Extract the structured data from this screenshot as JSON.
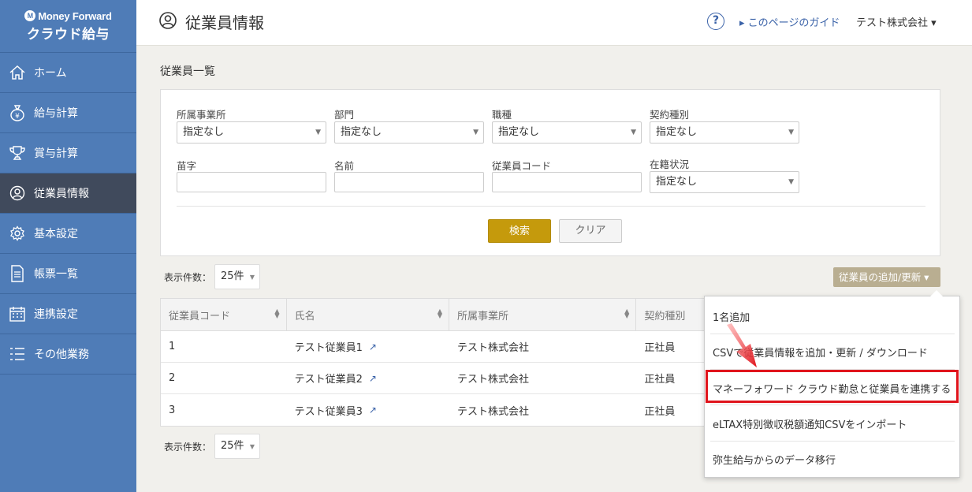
{
  "logo": {
    "brand": "Money Forward",
    "product": "クラウド給与"
  },
  "sidebar": {
    "items": [
      {
        "label": "ホーム",
        "icon": "home-icon",
        "active": false
      },
      {
        "label": "給与計算",
        "icon": "money-bag-icon",
        "active": false
      },
      {
        "label": "賞与計算",
        "icon": "trophy-icon",
        "active": false
      },
      {
        "label": "従業員情報",
        "icon": "user-icon",
        "active": true
      },
      {
        "label": "基本設定",
        "icon": "gear-icon",
        "active": false
      },
      {
        "label": "帳票一覧",
        "icon": "document-icon",
        "active": false
      },
      {
        "label": "連携設定",
        "icon": "calendar-icon",
        "active": false
      },
      {
        "label": "その他業務",
        "icon": "list-icon",
        "active": false
      }
    ]
  },
  "header": {
    "title": "従業員情報",
    "help": "?",
    "guide_link": "▸ このページのガイド",
    "company": "テスト株式会社 ▾"
  },
  "main": {
    "section_title": "従業員一覧",
    "filters": {
      "office_label": "所属事業所",
      "office_value": "指定なし",
      "dept_label": "部門",
      "dept_value": "指定なし",
      "job_label": "職種",
      "job_value": "指定なし",
      "contract_label": "契約種別",
      "contract_value": "指定なし",
      "surname_label": "苗字",
      "name_label": "名前",
      "code_label": "従業員コード",
      "status_label": "在籍状況",
      "status_value": "指定なし",
      "search_button": "検索",
      "clear_button": "クリア"
    },
    "per_page_label": "表示件数：",
    "per_page_value": "25件",
    "add_button": "従業員の追加/更新 ▾",
    "table": {
      "headers": [
        "従業員コード",
        "氏名",
        "所属事業所",
        "契約種別"
      ],
      "rows": [
        {
          "code": "1",
          "name": "テスト従業員1",
          "office": "テスト株式会社",
          "contract": "正社員"
        },
        {
          "code": "2",
          "name": "テスト従業員2",
          "office": "テスト株式会社",
          "contract": "正社員"
        },
        {
          "code": "3",
          "name": "テスト従業員3",
          "office": "テスト株式会社",
          "contract": "正社員"
        }
      ]
    }
  },
  "dropdown": {
    "items": [
      "1名追加",
      "CSVで従業員情報を追加・更新 / ダウンロード",
      "マネーフォワード クラウド勤怠と従業員を連携する",
      "eLTAX特別徴収税額通知CSVをインポート",
      "弥生給与からのデータ移行"
    ]
  },
  "colors": {
    "sidebar": "#4f7cb7",
    "active_nav": "#404a5c",
    "search_button": "#c59a0c",
    "highlight": "#e0141c"
  }
}
